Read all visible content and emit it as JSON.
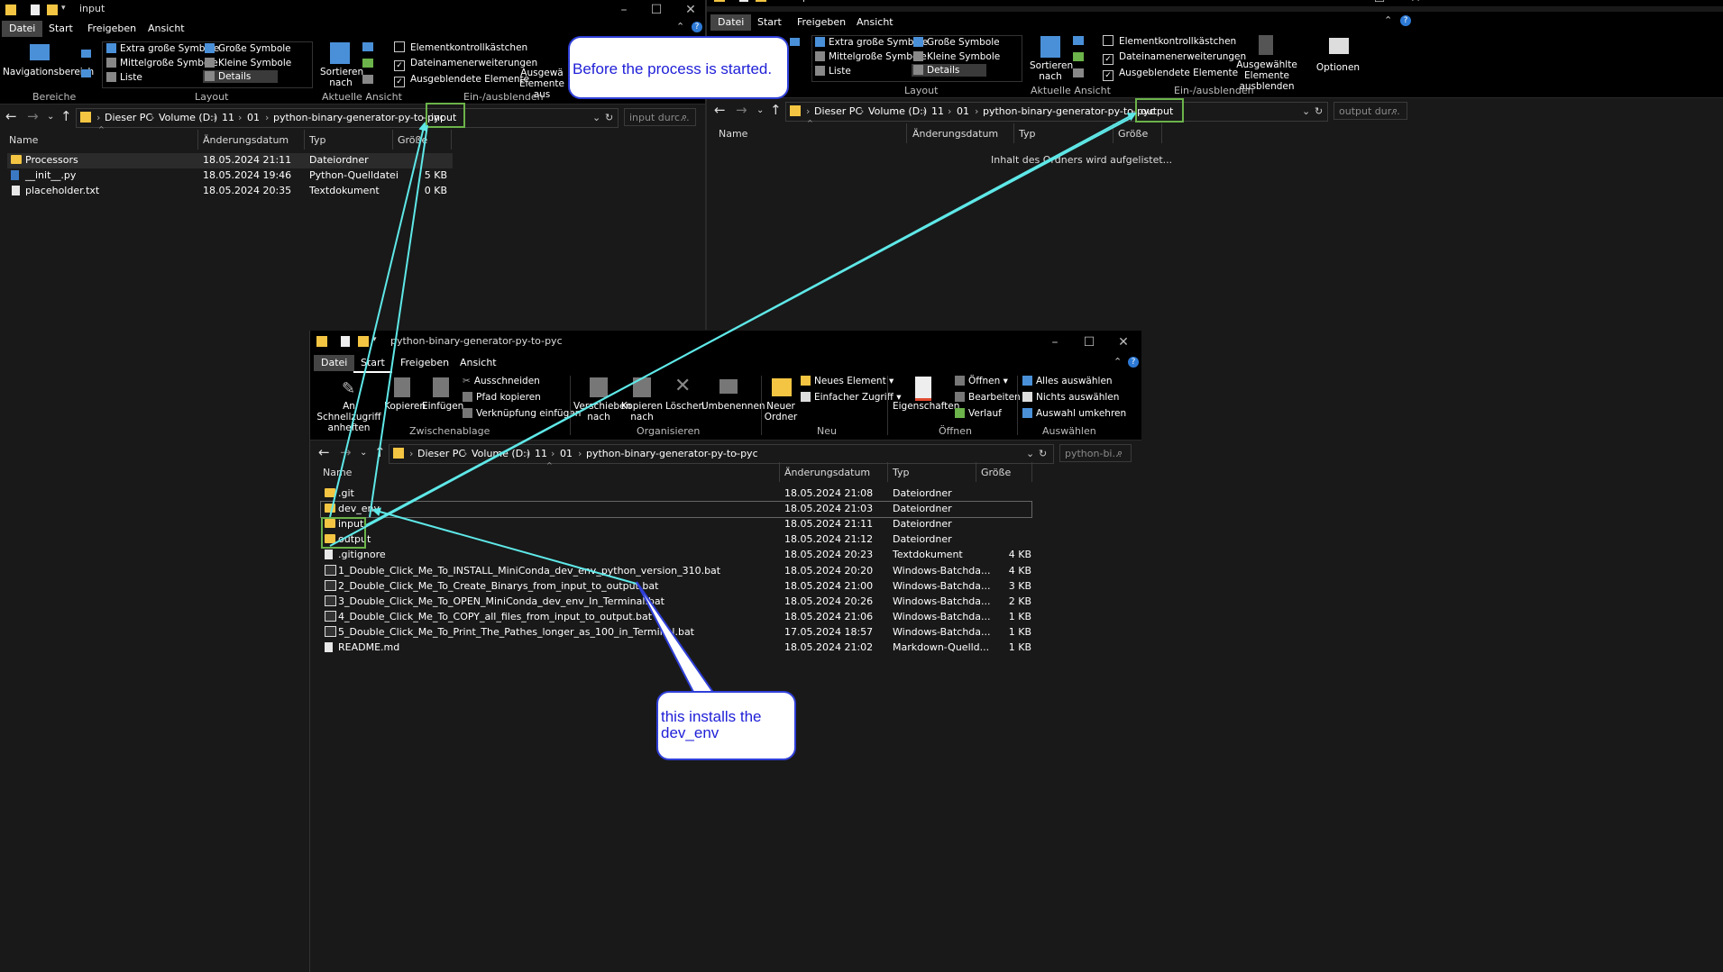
{
  "left_window": {
    "title": "input",
    "tabs": [
      "Datei",
      "Start",
      "Freigeben",
      "Ansicht"
    ],
    "ribbon": {
      "navigation_pane": "Navigationsbereich",
      "group_bereiche": "Bereiche",
      "layout_items": [
        "Extra große Symbole",
        "Große Symbole",
        "Mittelgroße Symbole",
        "Kleine Symbole",
        "Liste",
        "Details"
      ],
      "group_layout": "Layout",
      "sort_label": "Sortieren nach",
      "group_current_view": "Aktuelle Ansicht",
      "checkboxes": [
        {
          "label": "Elementkontrollkästchen",
          "checked": false
        },
        {
          "label": "Dateinamenerweiterungen",
          "checked": true
        },
        {
          "label": "Ausgeblendete Elemente",
          "checked": true
        }
      ],
      "hide_selected": "Ausgewä Elemente aus",
      "group_show_hide": "Ein-/ausblenden"
    },
    "breadcrumb": [
      "Dieser PC",
      "Volume (D:)",
      "11",
      "01",
      "python-binary-generator-py-to-pyc",
      "input"
    ],
    "search_placeholder": "input durc...",
    "columns": [
      "Name",
      "Änderungsdatum",
      "Typ",
      "Größe"
    ],
    "files": [
      {
        "name": "Processors",
        "date": "18.05.2024 21:11",
        "type": "Dateiordner",
        "size": "",
        "icon": "folder"
      },
      {
        "name": "__init__.py",
        "date": "18.05.2024 19:46",
        "type": "Python-Quelldatei",
        "size": "5 KB",
        "icon": "python"
      },
      {
        "name": "placeholder.txt",
        "date": "18.05.2024 20:35",
        "type": "Textdokument",
        "size": "0 KB",
        "icon": "text"
      }
    ]
  },
  "right_window": {
    "title": "output",
    "tabs": [
      "Datei",
      "Start",
      "Freigeben",
      "Ansicht"
    ],
    "ribbon": {
      "layout_items": [
        "Extra große Symbole",
        "Große Symbole",
        "Mittelgroße Symbole",
        "Kleine Symbole",
        "Liste",
        "Details"
      ],
      "group_layout": "Layout",
      "sort_label": "Sortieren nach",
      "group_current_view": "Aktuelle Ansicht",
      "checkboxes": [
        {
          "label": "Elementkontrollkästchen",
          "checked": false
        },
        {
          "label": "Dateinamenerweiterungen",
          "checked": true
        },
        {
          "label": "Ausgeblendete Elemente",
          "checked": true
        }
      ],
      "hide_selected": "Ausgewählte Elemente ausblenden",
      "group_show_hide": "Ein-/ausblenden",
      "options": "Optionen"
    },
    "breadcrumb": [
      "Dieser PC",
      "Volume (D:)",
      "11",
      "01",
      "python-binary-generator-py-to-pyc",
      "output"
    ],
    "search_placeholder": "output dur...",
    "columns": [
      "Name",
      "Änderungsdatum",
      "Typ",
      "Größe"
    ],
    "empty_message": "Inhalt des Ordners wird aufgelistet..."
  },
  "main_window": {
    "title": "python-binary-generator-py-to-pyc",
    "tabs": [
      "Datei",
      "Start",
      "Freigeben",
      "Ansicht"
    ],
    "ribbon": {
      "pin": "An Schnellzugriff anheften",
      "copy": "Kopieren",
      "paste": "Einfügen",
      "cut": "Ausschneiden",
      "copy_path": "Pfad kopieren",
      "paste_shortcut": "Verknüpfung einfügen",
      "group_clipboard": "Zwischenablage",
      "move_to": "Verschieben nach",
      "copy_to": "Kopieren nach",
      "delete": "Löschen",
      "rename": "Umbenennen",
      "group_organize": "Organisieren",
      "new_folder": "Neuer Ordner",
      "new_item": "Neues Element",
      "easy_access": "Einfacher Zugriff",
      "group_new": "Neu",
      "properties": "Eigenschaften",
      "open": "Öffnen",
      "edit": "Bearbeiten",
      "history": "Verlauf",
      "group_open": "Öffnen",
      "select_all": "Alles auswählen",
      "select_none": "Nichts auswählen",
      "invert_selection": "Auswahl umkehren",
      "group_select": "Auswählen"
    },
    "breadcrumb": [
      "Dieser PC",
      "Volume (D:)",
      "11",
      "01",
      "python-binary-generator-py-to-pyc"
    ],
    "search_placeholder": "python-bi...",
    "columns": [
      "Name",
      "Änderungsdatum",
      "Typ",
      "Größe"
    ],
    "files": [
      {
        "name": ".git",
        "date": "18.05.2024 21:08",
        "type": "Dateiordner",
        "size": "",
        "icon": "folder"
      },
      {
        "name": "dev_env",
        "date": "18.05.2024 21:03",
        "type": "Dateiordner",
        "size": "",
        "icon": "folder"
      },
      {
        "name": "input",
        "date": "18.05.2024 21:11",
        "type": "Dateiordner",
        "size": "",
        "icon": "folder"
      },
      {
        "name": "output",
        "date": "18.05.2024 21:12",
        "type": "Dateiordner",
        "size": "",
        "icon": "folder"
      },
      {
        "name": ".gitignore",
        "date": "18.05.2024 20:23",
        "type": "Textdokument",
        "size": "4 KB",
        "icon": "text"
      },
      {
        "name": "1_Double_Click_Me_To_INSTALL_MiniConda_dev_env_python_version_310.bat",
        "date": "18.05.2024 20:20",
        "type": "Windows-Batchda...",
        "size": "4 KB",
        "icon": "bat"
      },
      {
        "name": "2_Double_Click_Me_To_Create_Binarys_from_input_to_output.bat",
        "date": "18.05.2024 21:00",
        "type": "Windows-Batchda...",
        "size": "3 KB",
        "icon": "bat"
      },
      {
        "name": "3_Double_Click_Me_To_OPEN_MiniConda_dev_env_In_Terminal.bat",
        "date": "18.05.2024 20:26",
        "type": "Windows-Batchda...",
        "size": "2 KB",
        "icon": "bat"
      },
      {
        "name": "4_Double_Click_Me_To_COPY_all_files_from_input_to_output.bat",
        "date": "18.05.2024 21:06",
        "type": "Windows-Batchda...",
        "size": "1 KB",
        "icon": "bat"
      },
      {
        "name": "5_Double_Click_Me_To_Print_The_Pathes_longer_as_100_in_Terminal.bat",
        "date": "17.05.2024 18:57",
        "type": "Windows-Batchda...",
        "size": "1 KB",
        "icon": "bat"
      },
      {
        "name": "README.md",
        "date": "18.05.2024 21:02",
        "type": "Markdown-Quelld...",
        "size": "1 KB",
        "icon": "text"
      }
    ]
  },
  "annotations": {
    "callout_top": "Before the process is started.",
    "callout_bottom": "this installs the dev_env",
    "highlight_color": "#6bb34a",
    "arrow_color": "#5fe8e8",
    "callout_text_color": "#2020d8"
  }
}
